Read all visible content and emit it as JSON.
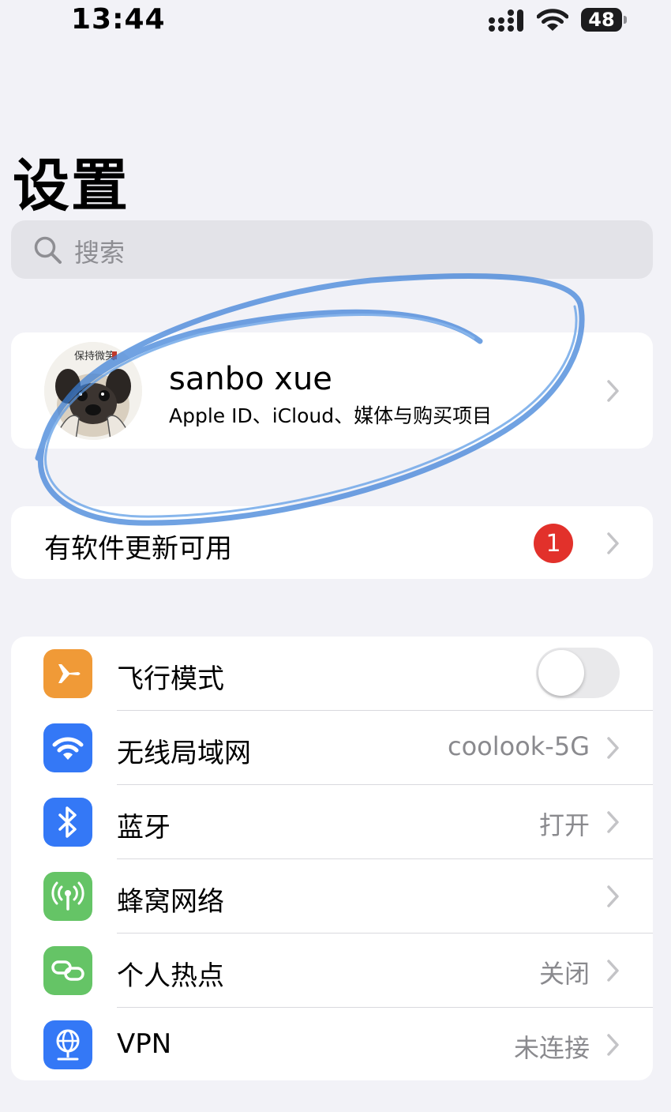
{
  "status_bar": {
    "time": "13:44",
    "battery": "48",
    "icons": [
      "cellular-signal-icon",
      "wifi-icon",
      "battery-icon"
    ]
  },
  "page": {
    "title": "设置"
  },
  "search": {
    "placeholder": "搜索"
  },
  "profile": {
    "name": "sanbo xue",
    "subtitle": "Apple ID、iCloud、媒体与购买项目",
    "avatar": "pug-avatar",
    "avatar_caption": "保持微笑"
  },
  "update": {
    "label": "有软件更新可用",
    "badge": "1",
    "badge_color": "#e2312b"
  },
  "settings": {
    "rows": [
      {
        "label": "飞行模式",
        "value": "",
        "icon": "airplane-icon",
        "icon_color": "#f09a37",
        "toggle": "off"
      },
      {
        "label": "无线局域网",
        "value": "coolook-5G",
        "icon": "wifi-icon",
        "icon_color": "#3478f6"
      },
      {
        "label": "蓝牙",
        "value": "打开",
        "icon": "bluetooth-icon",
        "icon_color": "#3478f6"
      },
      {
        "label": "蜂窝网络",
        "value": "",
        "icon": "antenna-icon",
        "icon_color": "#65c466"
      },
      {
        "label": "个人热点",
        "value": "关闭",
        "icon": "hotspot-link-icon",
        "icon_color": "#65c466"
      },
      {
        "label": "VPN",
        "value": "未连接",
        "icon": "vpn-globe-icon",
        "icon_color": "#3478f6"
      }
    ]
  },
  "annotation": {
    "scribble_color": "#3a7fd8"
  }
}
